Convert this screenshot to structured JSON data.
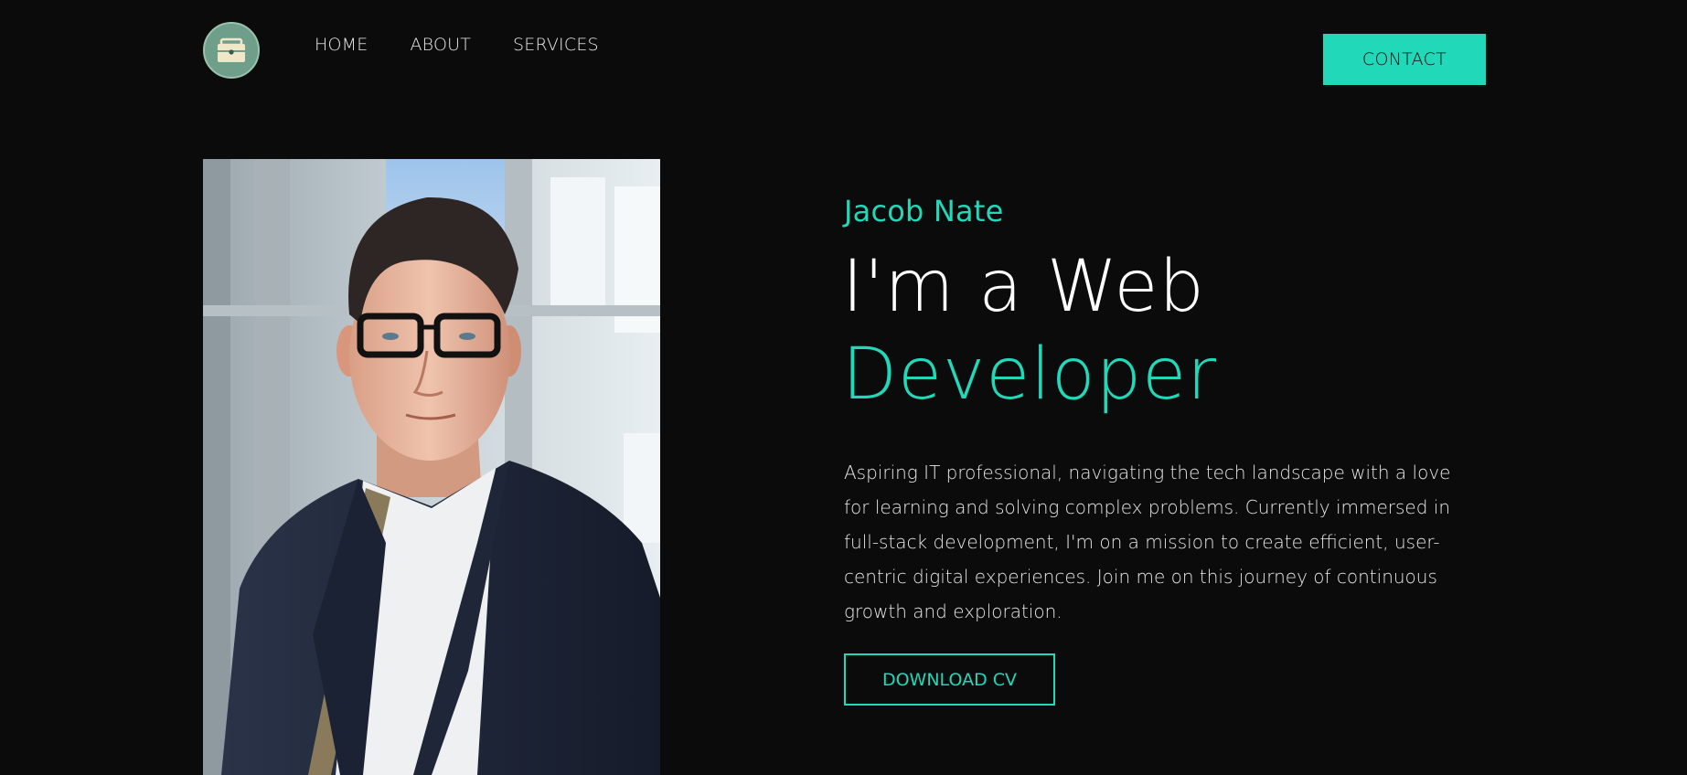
{
  "header": {
    "logo_icon": "briefcase-icon",
    "nav": {
      "home": "HOME",
      "about": "ABOUT",
      "services": "SERVICES"
    },
    "contact_label": "CONTACT"
  },
  "hero": {
    "name": "Jacob Nate",
    "headline_line1": "I'm a Web",
    "headline_line2": "Developer",
    "description": "Aspiring IT professional, navigating the tech landscape with a love for learning and solving complex problems. Currently immersed in full-stack development, I'm on a mission to create efficient, user-centric digital experiences. Join me on this journey of continuous growth and exploration.",
    "download_label": "DOWNLOAD CV"
  },
  "colors": {
    "background": "#0b0b0c",
    "accent": "#21d8b8",
    "logo_bg": "#6f9e8a",
    "text": "#ffffff"
  }
}
